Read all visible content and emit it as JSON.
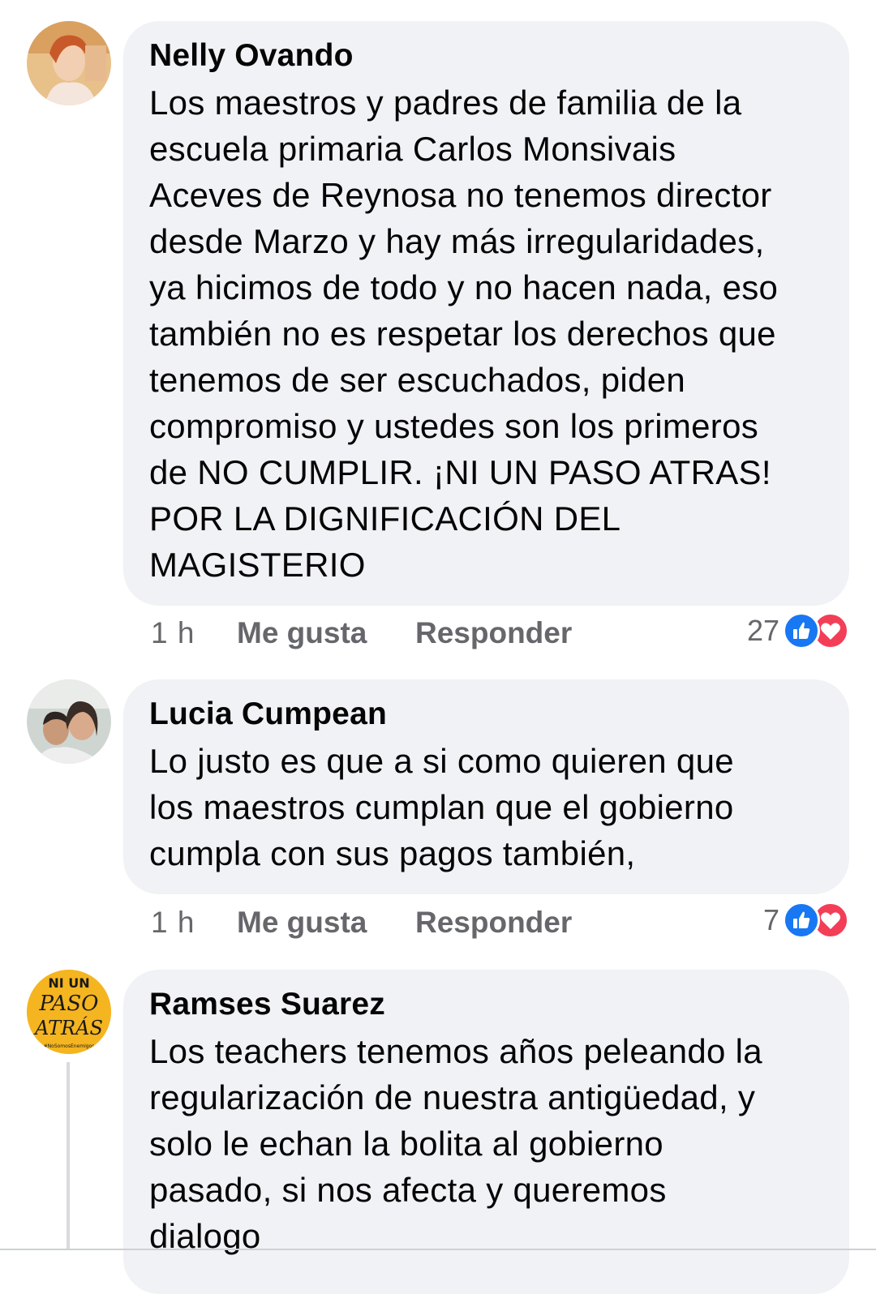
{
  "comments": [
    {
      "author": "Nelly Ovando",
      "text": "Los maestros y padres de familia de la\nescuela primaria Carlos Monsivais\nAceves de Reynosa no tenemos director\ndesde Marzo y hay más irregularidades,\nya hicimos de todo y no hacen nada, eso\ntambién no es respetar los derechos que\ntenemos de ser escuchados, piden\ncompromiso y ustedes son los primeros\nde NO CUMPLIR.  ¡NI UN PASO ATRAS!\nPOR LA DIGNIFICACIÓN DEL\nMAGISTERIO",
      "time": "1 h",
      "like_label": "Me gusta",
      "reply_label": "Responder",
      "reaction_count": "27",
      "reactions": [
        "like-icon",
        "love-icon"
      ]
    },
    {
      "author": "Lucia Cumpean",
      "text": "Lo justo es que a si como quieren que\nlos maestros cumplan que el gobierno\ncumpla con sus pagos también,",
      "time": "1 h",
      "like_label": "Me gusta",
      "reply_label": "Responder",
      "reaction_count": "7",
      "reactions": [
        "like-icon",
        "love-icon"
      ]
    },
    {
      "author": "Ramses Suarez",
      "text": "Los teachers tenemos años peleando la\nregularización  de nuestra antigüedad,  y\nsolo le echan la bolita al gobierno\npasado, si nos afecta y queremos\ndialogo",
      "avatar_text": [
        "NI UN",
        "PASO",
        "ATRÁS",
        "#NoSomosEnemigos"
      ]
    }
  ],
  "colors": {
    "bubble": "#f0f2f5",
    "meta_text": "#65676b",
    "like_blue": "#1877f2",
    "love_red": "#f33e58",
    "avatar3_bg": "#f5b520"
  }
}
